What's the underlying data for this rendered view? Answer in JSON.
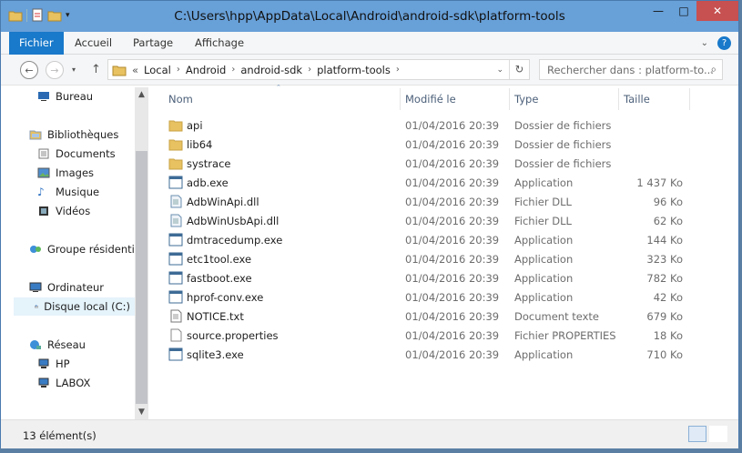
{
  "window": {
    "title": "C:\\Users\\hpp\\AppData\\Local\\Android\\android-sdk\\platform-tools"
  },
  "ribbon": {
    "tabs": [
      "Fichier",
      "Accueil",
      "Partage",
      "Affichage"
    ]
  },
  "address": {
    "prefix": "«",
    "crumbs": [
      "Local",
      "Android",
      "android-sdk",
      "platform-tools"
    ]
  },
  "search": {
    "placeholder": "Rechercher dans : platform-to..."
  },
  "nav": {
    "items": [
      {
        "label": "Bureau",
        "icon": "desktop-icon"
      },
      {
        "label": "Bibliothèques",
        "icon": "libraries-icon"
      },
      {
        "label": "Documents",
        "icon": "documents-icon"
      },
      {
        "label": "Images",
        "icon": "images-icon"
      },
      {
        "label": "Musique",
        "icon": "music-icon"
      },
      {
        "label": "Vidéos",
        "icon": "videos-icon"
      },
      {
        "label": "Groupe résidentie",
        "icon": "homegroup-icon"
      },
      {
        "label": "Ordinateur",
        "icon": "computer-icon"
      },
      {
        "label": "Disque local (C:)",
        "icon": "drive-icon"
      },
      {
        "label": "Réseau",
        "icon": "network-icon"
      },
      {
        "label": "HP",
        "icon": "pc-icon"
      },
      {
        "label": "LABOX",
        "icon": "pc-icon"
      }
    ]
  },
  "columns": {
    "name": "Nom",
    "modified": "Modifié le",
    "type": "Type",
    "size": "Taille"
  },
  "files": [
    {
      "name": "api",
      "date": "01/04/2016 20:39",
      "type": "Dossier de fichiers",
      "size": "",
      "icon": "folder-icon"
    },
    {
      "name": "lib64",
      "date": "01/04/2016 20:39",
      "type": "Dossier de fichiers",
      "size": "",
      "icon": "folder-icon"
    },
    {
      "name": "systrace",
      "date": "01/04/2016 20:39",
      "type": "Dossier de fichiers",
      "size": "",
      "icon": "folder-icon"
    },
    {
      "name": "adb.exe",
      "date": "01/04/2016 20:39",
      "type": "Application",
      "size": "1 437 Ko",
      "icon": "exe-icon"
    },
    {
      "name": "AdbWinApi.dll",
      "date": "01/04/2016 20:39",
      "type": "Fichier DLL",
      "size": "96 Ko",
      "icon": "dll-icon"
    },
    {
      "name": "AdbWinUsbApi.dll",
      "date": "01/04/2016 20:39",
      "type": "Fichier DLL",
      "size": "62 Ko",
      "icon": "dll-icon"
    },
    {
      "name": "dmtracedump.exe",
      "date": "01/04/2016 20:39",
      "type": "Application",
      "size": "144 Ko",
      "icon": "exe-icon"
    },
    {
      "name": "etc1tool.exe",
      "date": "01/04/2016 20:39",
      "type": "Application",
      "size": "323 Ko",
      "icon": "exe-icon"
    },
    {
      "name": "fastboot.exe",
      "date": "01/04/2016 20:39",
      "type": "Application",
      "size": "782 Ko",
      "icon": "exe-icon"
    },
    {
      "name": "hprof-conv.exe",
      "date": "01/04/2016 20:39",
      "type": "Application",
      "size": "42 Ko",
      "icon": "exe-icon"
    },
    {
      "name": "NOTICE.txt",
      "date": "01/04/2016 20:39",
      "type": "Document texte",
      "size": "679 Ko",
      "icon": "text-file-icon"
    },
    {
      "name": "source.properties",
      "date": "01/04/2016 20:39",
      "type": "Fichier PROPERTIES",
      "size": "18 Ko",
      "icon": "file-icon"
    },
    {
      "name": "sqlite3.exe",
      "date": "01/04/2016 20:39",
      "type": "Application",
      "size": "710 Ko",
      "icon": "exe-icon"
    }
  ],
  "status": {
    "count": "13 élément(s)"
  },
  "colors": {
    "file_tab": "#1979ca",
    "close_button": "#c75050",
    "title_bar": "#68a0d8",
    "folder": "#e8c160"
  }
}
